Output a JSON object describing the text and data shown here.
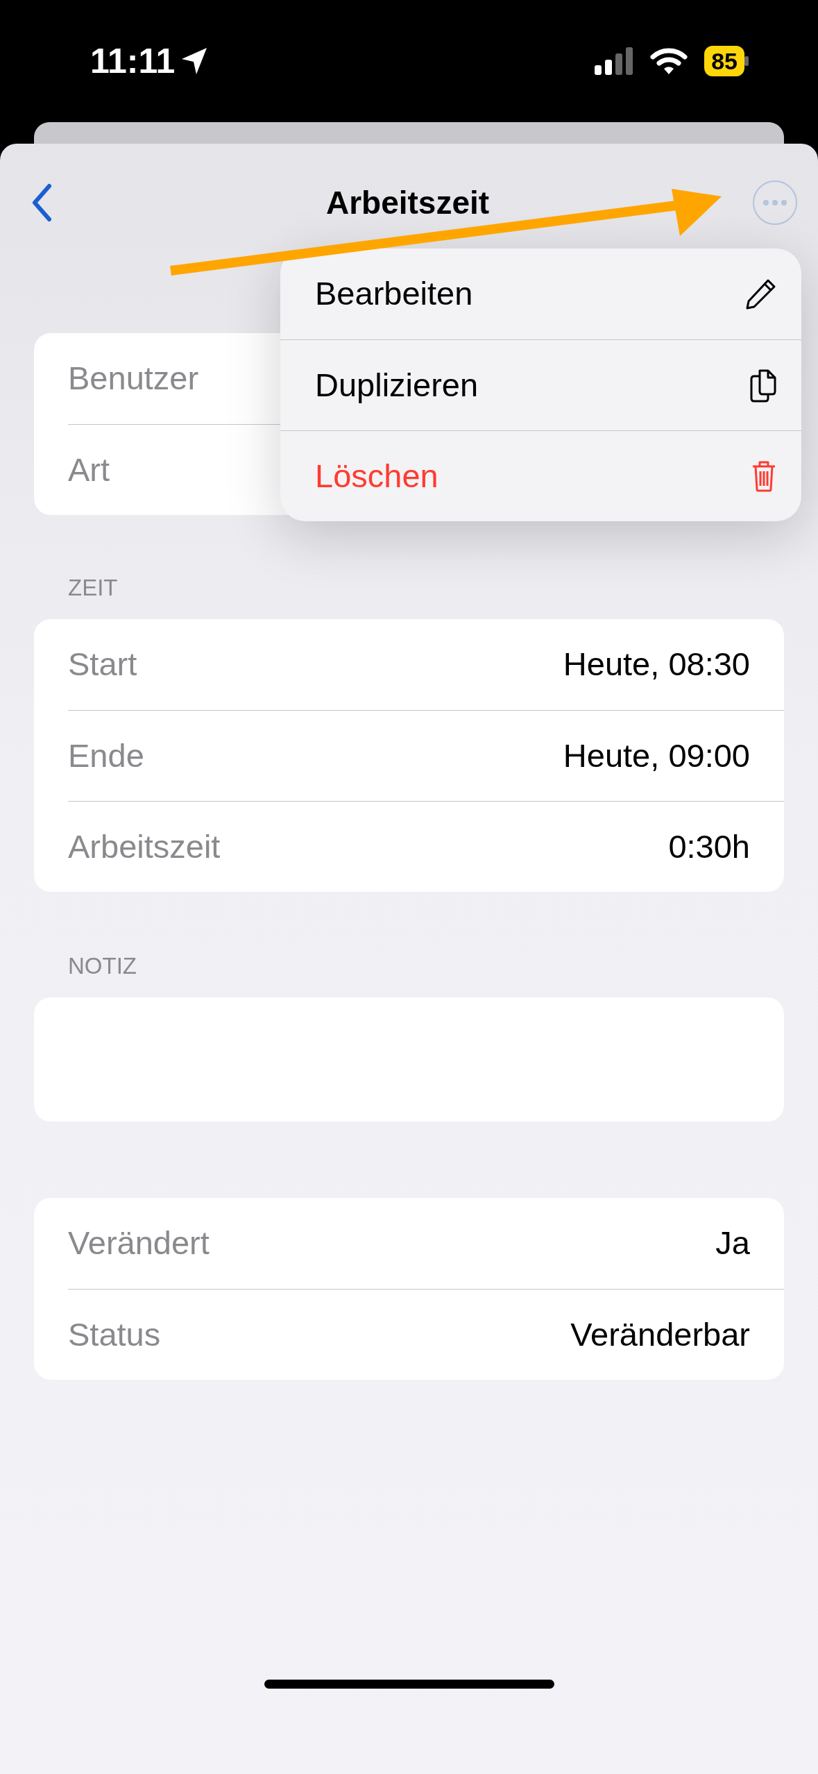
{
  "status_bar": {
    "time": "11:11",
    "battery": "85"
  },
  "nav": {
    "title": "Arbeitszeit"
  },
  "sections": [
    {
      "kind": "rows",
      "rows": [
        {
          "label": "Benutzer"
        },
        {
          "label": "Art"
        }
      ]
    },
    {
      "kind": "rows",
      "header": "ZEIT",
      "rows": [
        {
          "label": "Start",
          "value": "Heute, 08:30"
        },
        {
          "label": "Ende",
          "value": "Heute, 09:00"
        },
        {
          "label": "Arbeitszeit",
          "value": "0:30h"
        }
      ]
    },
    {
      "kind": "note",
      "header": "NOTIZ"
    },
    {
      "kind": "rows",
      "rows": [
        {
          "label": "Verändert",
          "value": "Ja"
        },
        {
          "label": "Status",
          "value": "Veränderbar"
        }
      ]
    }
  ],
  "menu": {
    "items": [
      {
        "label": "Bearbeiten",
        "kind": "edit",
        "destructive": false
      },
      {
        "label": "Duplizieren",
        "kind": "duplicate",
        "destructive": false
      },
      {
        "label": "Löschen",
        "kind": "delete",
        "destructive": true
      }
    ]
  }
}
